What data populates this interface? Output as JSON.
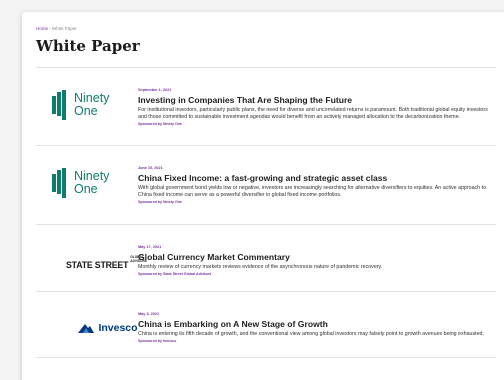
{
  "breadcrumb": {
    "home": "Home",
    "separator": " › ",
    "current": "White Paper"
  },
  "page_title": "White Paper",
  "colors": {
    "accent": "#7b2fa0",
    "ninety_one_green": "#0f7d6e",
    "invesco_blue": "#003a80"
  },
  "items": [
    {
      "logo": {
        "type": "ninety-one",
        "line1": "Ninety",
        "line2": "One"
      },
      "date": "September 1, 2021",
      "title": "Investing in Companies That Are Shaping the Future",
      "description": "For institutional investors, particularly public plans, the need for diverse and uncorrelated returns is paramount. Both traditional global equity investors and those committed to sustainable investment agendas would benefit from an actively managed allocation to the decarbonization theme.",
      "sponsor": "Sponsored by Ninety One"
    },
    {
      "logo": {
        "type": "ninety-one",
        "line1": "Ninety",
        "line2": "One"
      },
      "date": "June 10, 2021",
      "title": "China Fixed Income: a fast-growing and strategic asset class",
      "description": "With global government bond yields low or negative, investors are increasingly searching for alternative diversifiers to equities. An active approach to China fixed income can serve as a powerful diversifier in global fixed income portfolios.",
      "sponsor": "Sponsored by Ninety One"
    },
    {
      "logo": {
        "type": "state-street",
        "main": "STATE STREET",
        "sub1": "GLOBAL",
        "sub2": "ADVISORS"
      },
      "date": "May 17, 2021",
      "title": "Global Currency Market Commentary",
      "description": "Monthly review of currency markets reviews evidence of the asynchronous nature of pandemic recovery.",
      "sponsor": "Sponsored by State Street Global Advisors"
    },
    {
      "logo": {
        "type": "invesco",
        "name": "Invesco"
      },
      "date": "May 3, 2021",
      "title": "China is Embarking on A New Stage of Growth",
      "description": "China is entering its fifth decade of growth, and the conventional view among global investors may falsely point to growth avenues being exhausted.",
      "sponsor": "Sponsored by Invesco"
    }
  ]
}
